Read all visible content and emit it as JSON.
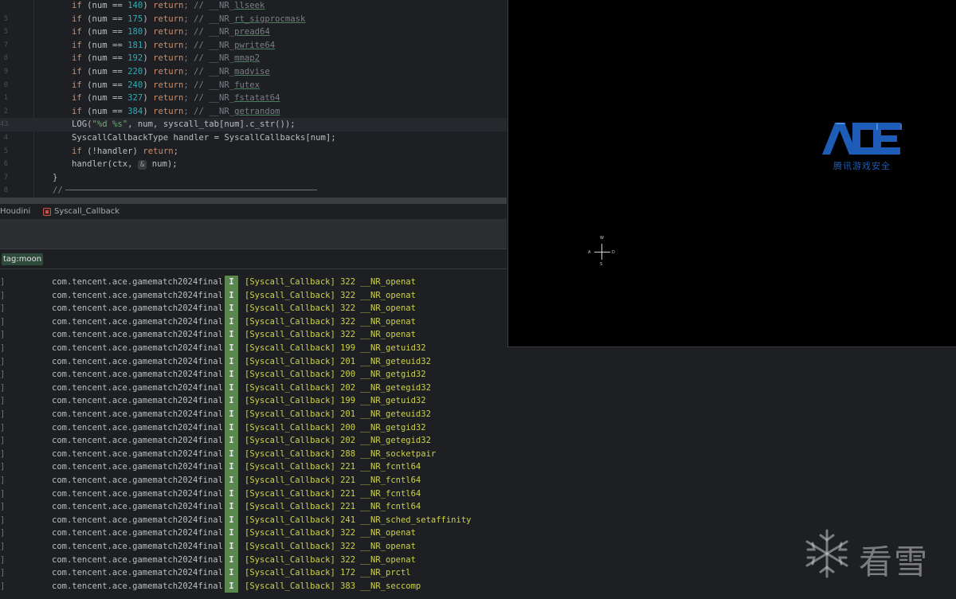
{
  "editor": {
    "gutter_numbers": [
      "",
      "5",
      "5",
      "7",
      "8",
      "9",
      "0",
      "1",
      "2",
      "43",
      "4",
      "5",
      "6",
      "7",
      "8"
    ],
    "lines": [
      {
        "a": "if",
        "b": " (num == ",
        "n": "140",
        "c": ") ",
        "r": "return",
        "d": "; // __NR_",
        "s": "llseek"
      },
      {
        "a": "if",
        "b": " (num == ",
        "n": "175",
        "c": ") ",
        "r": "return",
        "d": "; // __NR_",
        "s": "rt_sigprocmask"
      },
      {
        "a": "if",
        "b": " (num == ",
        "n": "180",
        "c": ") ",
        "r": "return",
        "d": "; // __NR_",
        "s": "pread64"
      },
      {
        "a": "if",
        "b": " (num == ",
        "n": "181",
        "c": ") ",
        "r": "return",
        "d": "; // __NR_",
        "s": "pwrite64"
      },
      {
        "a": "if",
        "b": " (num == ",
        "n": "192",
        "c": ") ",
        "r": "return",
        "d": "; // __NR_",
        "s": "mmap2"
      },
      {
        "a": "if",
        "b": " (num == ",
        "n": "220",
        "c": ") ",
        "r": "return",
        "d": "; // __NR_",
        "s": "madvise"
      },
      {
        "a": "if",
        "b": " (num == ",
        "n": "240",
        "c": ") ",
        "r": "return",
        "d": "; // __NR_",
        "s": "futex"
      },
      {
        "a": "if",
        "b": " (num == ",
        "n": "327",
        "c": ") ",
        "r": "return",
        "d": "; // __NR_",
        "s": "fstatat64"
      },
      {
        "a": "if",
        "b": " (num == ",
        "n": "384",
        "c": ") ",
        "r": "return",
        "d": "; // __NR_",
        "s": "getrandom"
      }
    ],
    "log_call": {
      "fn": "LOG(",
      "str": "\"%d %s\"",
      "rest": ", num, syscall_tab[num].c_str());"
    },
    "handler_decl": "SyscallCallbackType handler = SyscallCallbacks[num];",
    "if_handler": {
      "kw": "if",
      "mid": " (!handler) ",
      "ret": "return",
      "end": ";"
    },
    "handler_call": {
      "pre": "handler(ctx, ",
      "hint": "&",
      "post": " num);"
    },
    "close_brace": "}",
    "comment_rule": "//"
  },
  "breadcrumb": {
    "item1": "Houdini",
    "item2": "Syscall_Callback"
  },
  "filter": {
    "value": "tag:moon"
  },
  "log": {
    "package": "com.tencent.ace.gamematch2024final",
    "level": "I",
    "messages": [
      "[Syscall_Callback] 322 __NR_openat",
      "[Syscall_Callback] 322 __NR_openat",
      "[Syscall_Callback] 322 __NR_openat",
      "[Syscall_Callback] 322 __NR_openat",
      "[Syscall_Callback] 322 __NR_openat",
      "[Syscall_Callback] 199 __NR_getuid32",
      "[Syscall_Callback] 201 __NR_geteuid32",
      "[Syscall_Callback] 200 __NR_getgid32",
      "[Syscall_Callback] 202 __NR_getegid32",
      "[Syscall_Callback] 199 __NR_getuid32",
      "[Syscall_Callback] 201 __NR_geteuid32",
      "[Syscall_Callback] 200 __NR_getgid32",
      "[Syscall_Callback] 202 __NR_getegid32",
      "[Syscall_Callback] 288 __NR_socketpair",
      "[Syscall_Callback] 221 __NR_fcntl64",
      "[Syscall_Callback] 221 __NR_fcntl64",
      "[Syscall_Callback] 221 __NR_fcntl64",
      "[Syscall_Callback] 221 __NR_fcntl64",
      "[Syscall_Callback] 241 __NR_sched_setaffinity",
      "[Syscall_Callback] 322 __NR_openat",
      "[Syscall_Callback] 322 __NR_openat",
      "[Syscall_Callback] 322 __NR_openat",
      "[Syscall_Callback] 172 __NR_prctl",
      "[Syscall_Callback] 383 __NR_seccomp"
    ]
  },
  "device": {
    "logo_text": "ACE",
    "logo_subtitle": "腾讯游戏安全",
    "compass": {
      "n": "W",
      "w": "A",
      "e": "D",
      "s": "S"
    },
    "logo_color": "#1d5db8"
  },
  "watermark": {
    "text": "看雪",
    "icon": "snowflake-icon"
  }
}
